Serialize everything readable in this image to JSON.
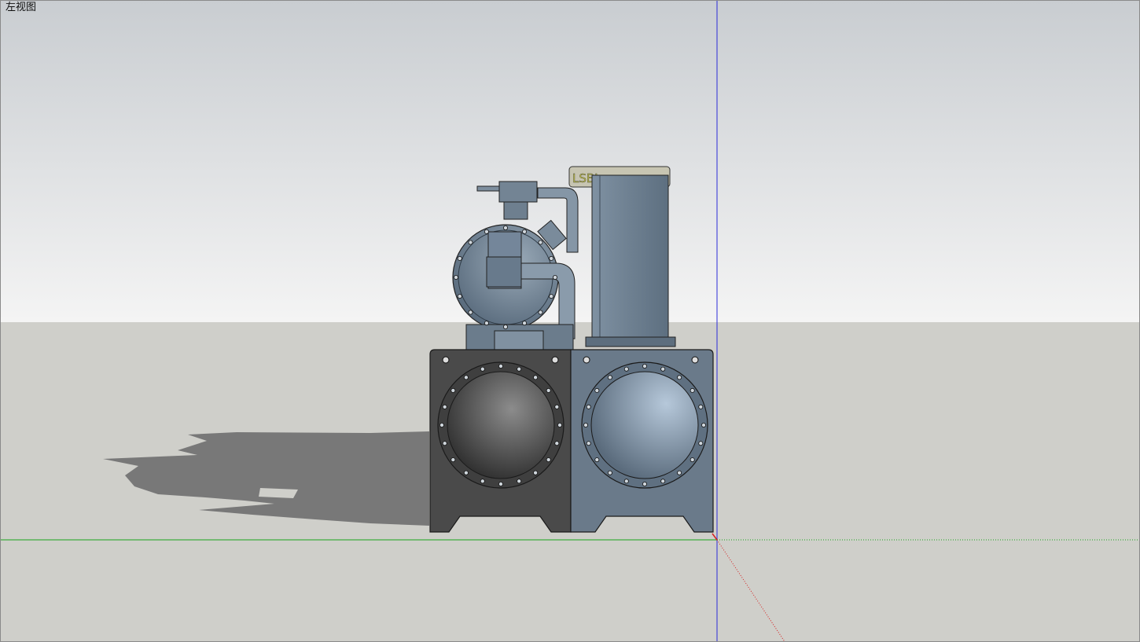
{
  "viewport": {
    "view_name": "左视图"
  },
  "model": {
    "nameplate_text": "LSBL",
    "colors": {
      "sky_top": "#c9cdd1",
      "sky_bottom": "#f4f4f4",
      "ground": "#cfcfca",
      "machine_body": "#6c7d8c",
      "machine_dark": "#4c4c4c",
      "shadow": "#787878",
      "axis_blue": "#2b2bd8",
      "axis_green": "#19a619",
      "axis_red": "#d42020"
    }
  }
}
